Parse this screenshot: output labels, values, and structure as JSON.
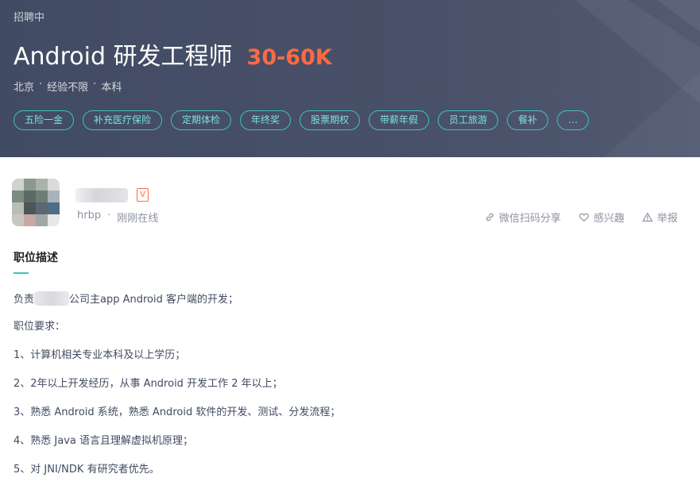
{
  "banner": {
    "status": "招聘中",
    "title": "Android 研发工程师",
    "salary": "30-60K",
    "meta": [
      "北京",
      "经验不限",
      "本科"
    ],
    "tags": [
      "五险一金",
      "补充医疗保险",
      "定期体检",
      "年终奖",
      "股票期权",
      "带薪年假",
      "员工旅游",
      "餐补",
      "…"
    ]
  },
  "recruiter": {
    "badge": "V",
    "role": "hrbp",
    "separator": "·",
    "online": "刚刚在线",
    "actions": {
      "share": "微信扫码分享",
      "interest": "感兴趣",
      "report": "举报"
    }
  },
  "description": {
    "title": "职位描述",
    "line1_prefix": "负责",
    "line1_suffix": "公司主app Android 客户端的开发；",
    "lines": [
      "职位要求：",
      "1、计算机相关专业本科及以上学历；",
      "2、2年以上开发经历，从事 Android 开发工作 2 年以上；",
      "3、熟悉 Android 系统，熟悉 Android 软件的开发、测试、分发流程；",
      "4、熟悉 Java 语言且理解虚拟机原理；",
      "5、对 JNI/NDK 有研究者优先。"
    ]
  },
  "colors": {
    "banner_bg": "#434c64",
    "salary": "#fd6a42",
    "tag_border": "#3fc0bf",
    "tag_text": "#7fe0db",
    "accent": "#3fc0bf"
  }
}
